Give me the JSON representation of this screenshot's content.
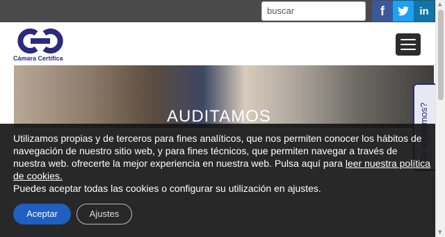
{
  "topbar": {
    "search_placeholder": "buscar",
    "social": [
      {
        "icon": "facebook-icon",
        "glyph": "f"
      },
      {
        "icon": "twitter-icon"
      },
      {
        "icon": "linkedin-icon",
        "glyph": "in"
      }
    ]
  },
  "header": {
    "logo_text": "Cámara Certifica",
    "menu_icon": "hamburger-menu-icon"
  },
  "hero": {
    "title": "AUDITAMOS"
  },
  "help_tab": {
    "label": "¿Te ayudamos?"
  },
  "cookie_banner": {
    "text_before_link": "Utilizamos propias y de terceros para fines analíticos, que nos permiten conocer los hábitos de navegación de nuestro sitio web,  y para fines técnicos, que permiten navegar a través de nuestra web. ofrecerte la mejor experiencia en nuestra web. Pulsa aquí para ",
    "link_text": "leer nuestra política de cookies.",
    "text_after_link": "Puedes aceptar todas las cookies o configurar su utilización en ajustes.",
    "accept_label": "Aceptar",
    "settings_label": "Ajustes"
  },
  "colors": {
    "brand": "#2a2a7e",
    "topbar": "#4a4a4a",
    "facebook": "#3b5998",
    "twitter": "#1da1f2",
    "linkedin": "#0e76a8",
    "accept": "#1f5fbf"
  }
}
